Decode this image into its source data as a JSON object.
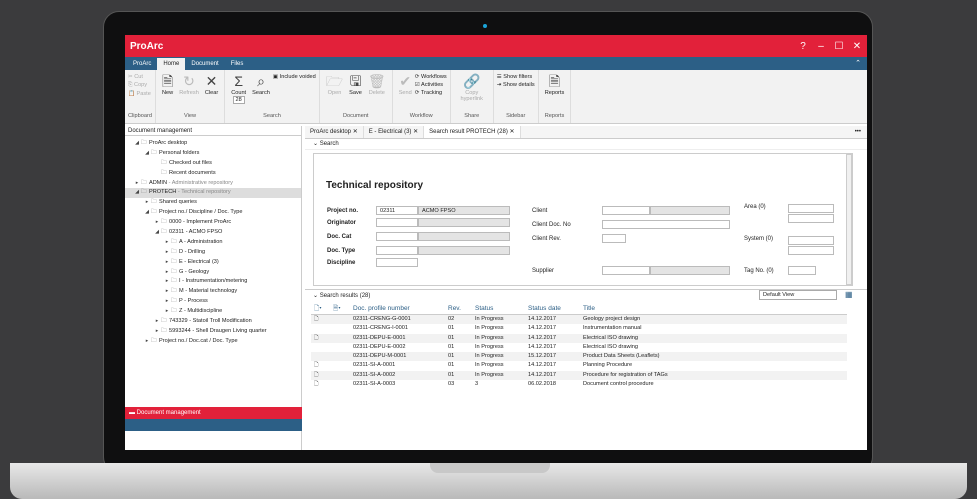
{
  "app": {
    "title": "ProArc",
    "help": "?",
    "minimize": "–",
    "maximize": "☐",
    "close": "✕"
  },
  "ribbon_tabs": [
    "ProArc",
    "Home",
    "Document",
    "Files"
  ],
  "ribbon": {
    "clipboard": {
      "label": "Clipboard",
      "cut": "Cut",
      "copy": "Copy",
      "paste": "Paste"
    },
    "view": {
      "label": "View",
      "new": "New",
      "refresh": "Refresh",
      "clear": "Clear"
    },
    "search": {
      "label": "Search",
      "count": "Count",
      "count_value": "28",
      "search": "Search",
      "include_voided": "Include voided"
    },
    "document": {
      "label": "Document",
      "open": "Open",
      "save": "Save",
      "delete": "Delete"
    },
    "workflow": {
      "label": "Workflow",
      "send": "Send",
      "workflows": "Workflows",
      "activities": "Activities",
      "tracking": "Tracking"
    },
    "share": {
      "label": "Share",
      "copy_hyperlink": "Copy hyperlink"
    },
    "sidebar": {
      "label": "Sidebar",
      "show_filters": "Show filters",
      "show_details": "Show details"
    },
    "reports": {
      "label": "Reports",
      "reports": "Reports"
    }
  },
  "left_panel": {
    "title": "Document management",
    "tree": [
      {
        "label": "ProArc desktop",
        "sub": ""
      },
      {
        "label": "Personal folders",
        "sub": ""
      },
      {
        "label": "Checked out files",
        "sub": ""
      },
      {
        "label": "Recent documents",
        "sub": ""
      },
      {
        "label": "ADMIN",
        "sub": " - Administrative repository"
      },
      {
        "label": "PROTECH",
        "sub": " - Technical repository"
      },
      {
        "label": "Shared queries",
        "sub": ""
      },
      {
        "label": "Project no./ Discipline / Doc. Type",
        "sub": ""
      },
      {
        "label": "0000 - Implement ProArc",
        "sub": ""
      },
      {
        "label": "02311 - ACMO FPSO",
        "sub": ""
      },
      {
        "label": "A - Administration",
        "sub": ""
      },
      {
        "label": "D - Drilling",
        "sub": ""
      },
      {
        "label": "E - Electrical (3)",
        "sub": ""
      },
      {
        "label": "G - Geology",
        "sub": ""
      },
      {
        "label": "I - Instrumentation/metering",
        "sub": ""
      },
      {
        "label": "M - Material technology",
        "sub": ""
      },
      {
        "label": "P - Process",
        "sub": ""
      },
      {
        "label": "Z - Multidiscipline",
        "sub": ""
      },
      {
        "label": "743329 - Statoil Troll Modification",
        "sub": ""
      },
      {
        "label": "5993244 - Shell Draugen Living quarter",
        "sub": ""
      },
      {
        "label": "Project no./ Doc.cat / Doc. Type",
        "sub": ""
      }
    ],
    "footer": "Document management"
  },
  "doc_tabs": [
    "ProArc desktop",
    "E - Electrical (3)",
    "Search result PROTECH (28)"
  ],
  "search_panel": {
    "header": "Search",
    "title": "Technical repository",
    "project_no_label": "Project no.",
    "project_no": "02311",
    "project_name": "ACMO FPSO",
    "originator_label": "Originator",
    "doc_cat_label": "Doc. Cat",
    "doc_type_label": "Doc. Type",
    "discipline_label": "Discipline",
    "client_label": "Client",
    "client_doc_label": "Client Doc. No",
    "client_rev_label": "Client Rev.",
    "supplier_label": "Supplier",
    "area_label": "Area (0)",
    "system_label": "System (0)",
    "tag_label": "Tag No. (0)"
  },
  "results": {
    "header": "Search results (28)",
    "view": "Default View",
    "columns": [
      "Doc. profile number",
      "Rev.",
      "Status",
      "Status date",
      "Title"
    ],
    "rows": [
      [
        "02311-CRENG-G-0001",
        "02",
        "In Progress",
        "14.12.2017",
        "Geology project design"
      ],
      [
        "02311-CRENG-I-0001",
        "01",
        "In Progress",
        "14.12.2017",
        "Instrumentation manual"
      ],
      [
        "02311-DEPU-E-0001",
        "01",
        "In Progress",
        "14.12.2017",
        "Electrical ISO drawing"
      ],
      [
        "02311-DEPU-E-0002",
        "01",
        "In Progress",
        "14.12.2017",
        "Electrical ISO drawing"
      ],
      [
        "02311-DEPU-M-0001",
        "01",
        "In Progress",
        "15.12.2017",
        "Product Data Sheets (Leaflets)"
      ],
      [
        "02311-SI-A-0001",
        "01",
        "In Progress",
        "14.12.2017",
        "Planning Procedure"
      ],
      [
        "02311-SI-A-0002",
        "01",
        "In Progress",
        "14.12.2017",
        "Procedure for registration of TAGs"
      ],
      [
        "02311-SI-A-0003",
        "03",
        "3",
        "06.02.2018",
        "Document control procedure"
      ]
    ]
  }
}
